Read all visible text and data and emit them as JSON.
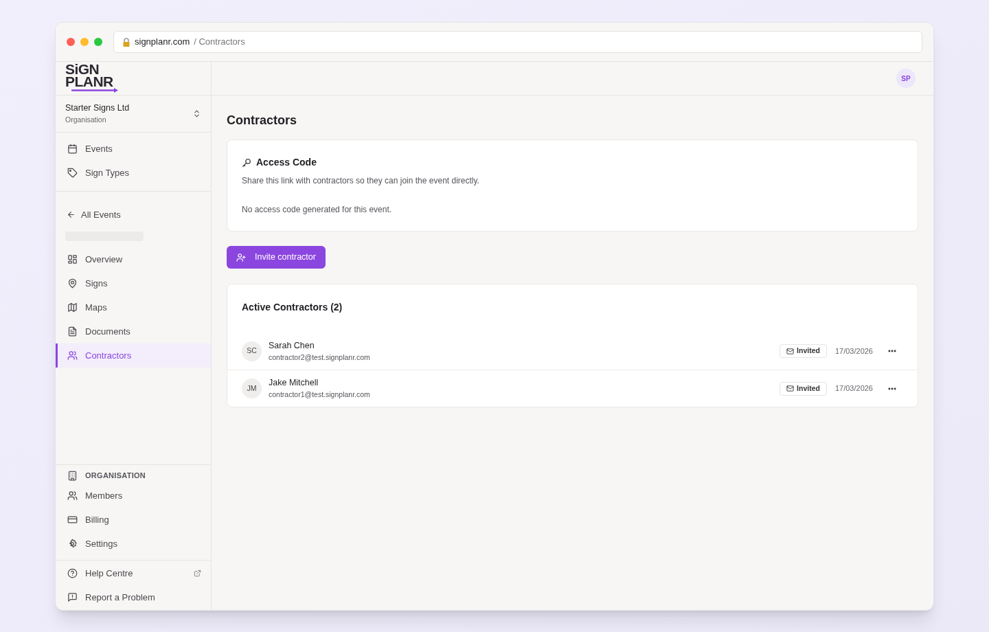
{
  "browser": {
    "domain": "signplanr.com",
    "path": "/ Contractors"
  },
  "logo": {
    "line_1": "SiGN",
    "line_2": "PLANR"
  },
  "organisation": {
    "name": "Starter Signs Ltd",
    "label": "Organisation"
  },
  "org_nav": [
    {
      "label": "Events",
      "selected": false
    },
    {
      "label": "Sign Types",
      "selected": false
    }
  ],
  "back_link": "All Events",
  "event_nav": [
    {
      "label": "Overview",
      "selected": false
    },
    {
      "label": "Signs",
      "selected": false
    },
    {
      "label": "Maps",
      "selected": false
    },
    {
      "label": "Documents",
      "selected": false
    },
    {
      "label": "Contractors",
      "selected": true
    }
  ],
  "organisation_section": {
    "heading": "ORGANISATION",
    "items": [
      {
        "label": "Members"
      },
      {
        "label": "Billing"
      },
      {
        "label": "Settings"
      }
    ]
  },
  "footer_nav": [
    {
      "label": "Help Centre",
      "external": true
    },
    {
      "label": "Report a Problem",
      "external": false
    }
  ],
  "user_avatar": "SP",
  "page_title": "Contractors",
  "access_code": {
    "title": "Access Code",
    "description": "Share this link with contractors so they can join the event directly.",
    "status": "No access code generated for this event."
  },
  "invite_button": "Invite contractor",
  "contractors": {
    "title": "Active Contractors (2)",
    "rows": [
      {
        "initials": "SC",
        "name": "Sarah Chen",
        "email": "contractor2@test.signplanr.com",
        "status": "Invited",
        "date": "17/03/2026"
      },
      {
        "initials": "JM",
        "name": "Jake Mitchell",
        "email": "contractor1@test.signplanr.com",
        "status": "Invited",
        "date": "17/03/2026"
      }
    ]
  }
}
